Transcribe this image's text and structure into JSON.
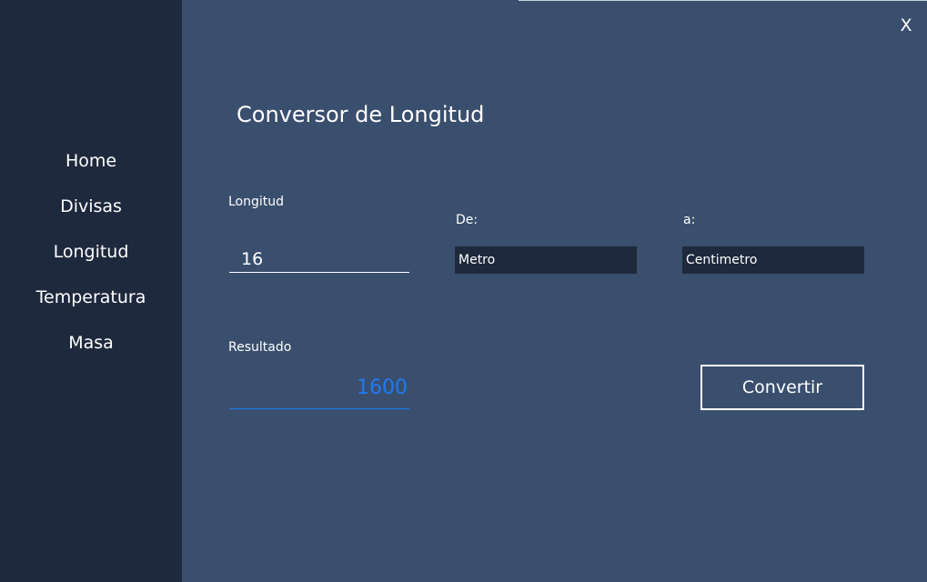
{
  "window": {
    "close_label": "X"
  },
  "sidebar": {
    "items": [
      {
        "label": "Home"
      },
      {
        "label": "Divisas"
      },
      {
        "label": "Longitud"
      },
      {
        "label": "Temperatura"
      },
      {
        "label": "Masa"
      }
    ]
  },
  "main": {
    "title": "Conversor de Longitud",
    "length_label": "Longitud",
    "length_value": "16",
    "from_label": "De:",
    "from_unit": "Metro",
    "to_label": "a:",
    "to_unit": "Centimetro",
    "result_label": "Resultado",
    "result_value": "1600",
    "convert_label": "Convertir"
  },
  "colors": {
    "sidebar_bg": "#1e293d",
    "content_bg": "#3a4f6e",
    "accent": "#1e7bf2",
    "text": "#ffffff"
  }
}
